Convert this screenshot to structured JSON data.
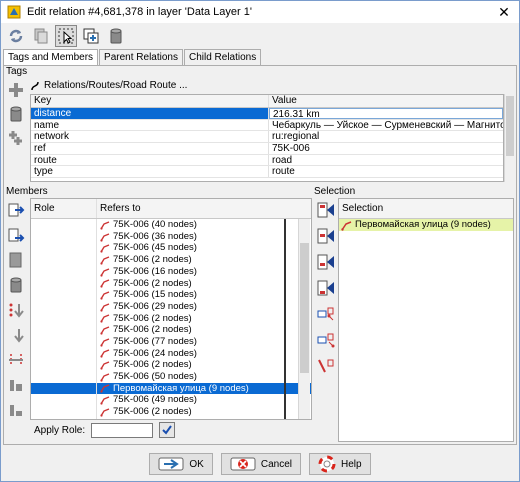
{
  "window": {
    "title": "Edit relation #4,681,378 in layer 'Data Layer 1'",
    "close_glyph": "✕"
  },
  "tabs": [
    {
      "label": "Tags and Members"
    },
    {
      "label": "Parent Relations"
    },
    {
      "label": "Child Relations"
    }
  ],
  "tags": {
    "section_label": "Tags",
    "preset": "Relations/Routes/Road Route ...",
    "header": {
      "key": "Key",
      "value": "Value"
    },
    "rows": [
      {
        "key": "distance",
        "value": "216.31 km"
      },
      {
        "key": "name",
        "value": "Чебаркуль — Уйское — Сурменевский — Магнитогорск"
      },
      {
        "key": "network",
        "value": "ru:regional"
      },
      {
        "key": "ref",
        "value": "75K-006"
      },
      {
        "key": "route",
        "value": "road"
      },
      {
        "key": "type",
        "value": "route"
      }
    ]
  },
  "members": {
    "section_label": "Members",
    "header": {
      "role": "Role",
      "refers_to": "Refers to"
    },
    "rows": [
      {
        "role": "",
        "ref": "75K-006 (40 nodes)"
      },
      {
        "role": "",
        "ref": "75K-006 (36 nodes)"
      },
      {
        "role": "",
        "ref": "75K-006 (45 nodes)"
      },
      {
        "role": "",
        "ref": "75K-006 (2 nodes)"
      },
      {
        "role": "",
        "ref": "75K-006 (16 nodes)"
      },
      {
        "role": "",
        "ref": "75K-006 (2 nodes)"
      },
      {
        "role": "",
        "ref": "75K-006 (15 nodes)"
      },
      {
        "role": "",
        "ref": "75K-006 (29 nodes)"
      },
      {
        "role": "",
        "ref": "75K-006 (2 nodes)"
      },
      {
        "role": "",
        "ref": "75K-006 (2 nodes)"
      },
      {
        "role": "",
        "ref": "75K-006 (77 nodes)"
      },
      {
        "role": "",
        "ref": "75K-006 (24 nodes)"
      },
      {
        "role": "",
        "ref": "75K-006 (2 nodes)"
      },
      {
        "role": "",
        "ref": "75K-006 (50 nodes)"
      },
      {
        "role": "",
        "ref": "Первомайская улица (9 nodes)"
      },
      {
        "role": "",
        "ref": "75K-006 (49 nodes)"
      },
      {
        "role": "",
        "ref": "75K-006 (2 nodes)"
      },
      {
        "role": "",
        "ref": "75K-006 (2 nodes)"
      }
    ],
    "apply_role_label": "Apply Role:",
    "apply_role_value": ""
  },
  "selection": {
    "section_label": "Selection",
    "header": "Selection",
    "items": [
      {
        "label": "Первомайская улица (9 nodes)"
      }
    ]
  },
  "buttons": {
    "ok": "OK",
    "cancel": "Cancel",
    "help": "Help"
  }
}
